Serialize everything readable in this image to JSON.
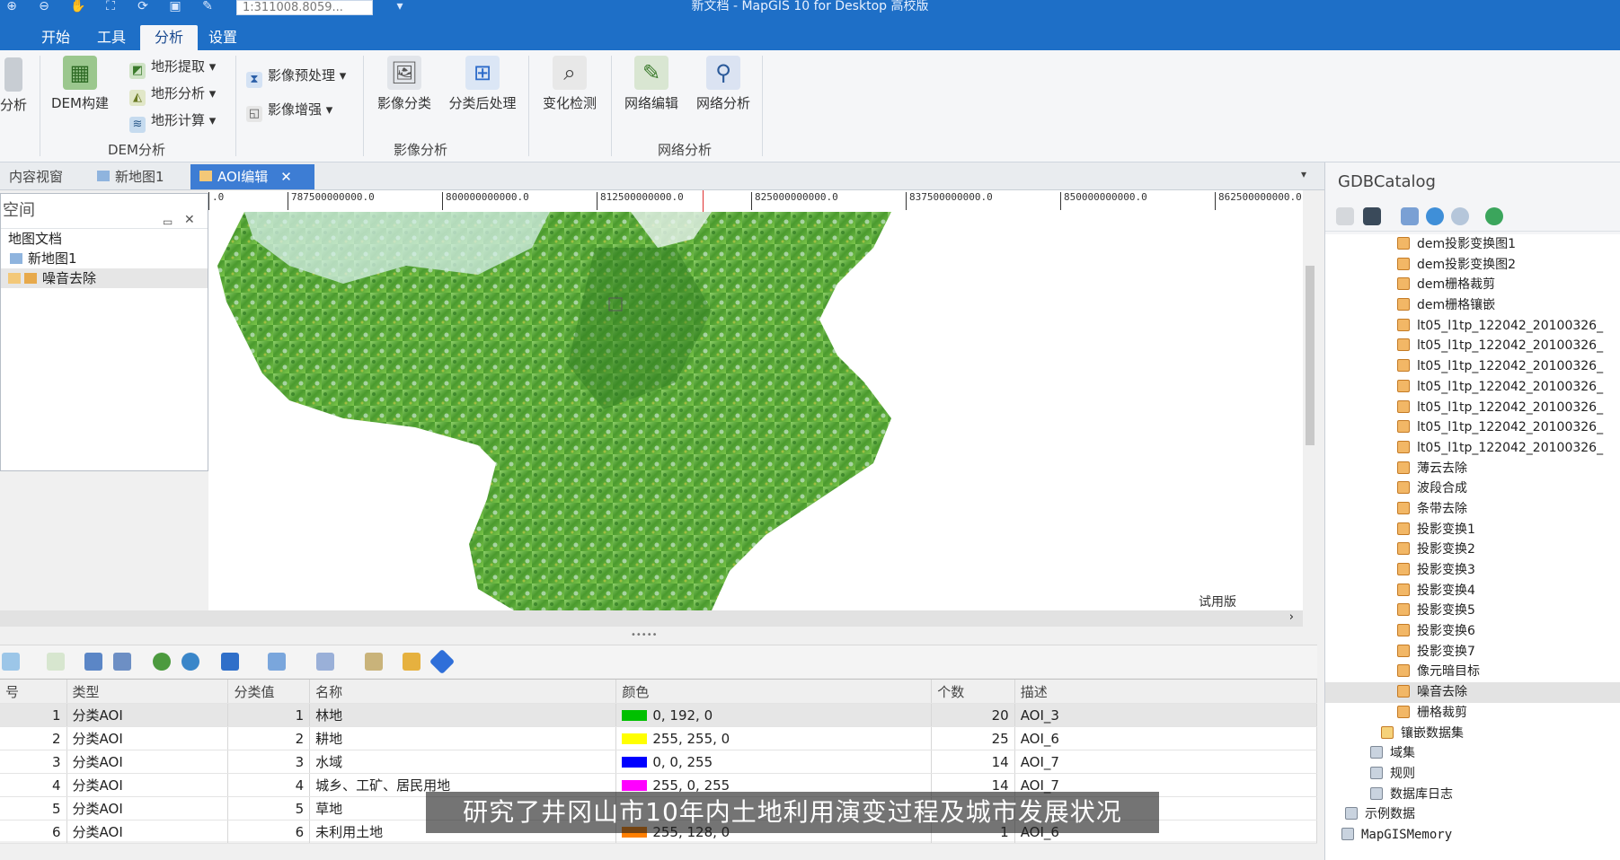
{
  "window": {
    "title": "新文档 - MapGIS 10 for Desktop 高校版",
    "scale_value": "1:311008.8059..."
  },
  "ribbon_tabs": [
    {
      "label": "开始"
    },
    {
      "label": "工具"
    },
    {
      "label": "分析"
    },
    {
      "label": "设置"
    }
  ],
  "ribbon": {
    "partial_left": "分析",
    "dem_build": "DEM构建",
    "terrain_extract": "地形提取",
    "terrain_analysis": "地形分析",
    "terrain_calc": "地形计算",
    "group_dem": "DEM分析",
    "img_preprocess": "影像预处理",
    "img_enhance": "影像增强",
    "img_classify": "影像分类",
    "post_classify": "分类后处理",
    "change_detect": "变化检测",
    "group_image": "影像分析",
    "net_edit": "网络编辑",
    "net_analysis": "网络分析",
    "group_network": "网络分析"
  },
  "doc_tabs": [
    {
      "label": "内容视窗"
    },
    {
      "label": "新地图1"
    },
    {
      "label": "AOI编辑"
    }
  ],
  "ruler_ticks": [
    ".0",
    "787500000000.0",
    "800000000000.0",
    "812500000000.0",
    "825000000000.0",
    "837500000000.0",
    "850000000000.0",
    "862500000000.0"
  ],
  "left_panel": {
    "title": "空间",
    "items": [
      "地图文档",
      "新地图1",
      "噪音去除"
    ]
  },
  "map": {
    "trial_label": "试用版"
  },
  "table": {
    "headers": [
      "号",
      "类型",
      "分类值",
      "名称",
      "颜色",
      "个数",
      "描述"
    ],
    "rows": [
      {
        "id": "1",
        "type": "分类AOI",
        "val": "1",
        "name": "林地",
        "color": "0, 192, 0",
        "hex": "#00c000",
        "count": "20",
        "desc": "AOI_3"
      },
      {
        "id": "2",
        "type": "分类AOI",
        "val": "2",
        "name": "耕地",
        "color": "255, 255, 0",
        "hex": "#ffff00",
        "count": "25",
        "desc": "AOI_6"
      },
      {
        "id": "3",
        "type": "分类AOI",
        "val": "3",
        "name": "水域",
        "color": "0, 0, 255",
        "hex": "#0000ff",
        "count": "14",
        "desc": "AOI_7"
      },
      {
        "id": "4",
        "type": "分类AOI",
        "val": "4",
        "name": "城乡、工矿、居民用地",
        "color": "255, 0, 255",
        "hex": "#ff00ff",
        "count": "14",
        "desc": "AOI_7"
      },
      {
        "id": "5",
        "type": "分类AOI",
        "val": "5",
        "name": "草地",
        "color": "",
        "hex": "",
        "count": "",
        "desc": ""
      },
      {
        "id": "6",
        "type": "分类AOI",
        "val": "6",
        "name": "未利用土地",
        "color": "255, 128, 0",
        "hex": "#ff8000",
        "count": "1",
        "desc": "AOI_6"
      }
    ]
  },
  "catalog": {
    "title": "GDBCatalog",
    "items": [
      {
        "label": "dem投影变换图1",
        "indent": 1
      },
      {
        "label": "dem投影变换图2",
        "indent": 1
      },
      {
        "label": "dem栅格裁剪",
        "indent": 1
      },
      {
        "label": "dem栅格镶嵌",
        "indent": 1
      },
      {
        "label": "lt05_l1tp_122042_20100326_",
        "indent": 1
      },
      {
        "label": "lt05_l1tp_122042_20100326_",
        "indent": 1
      },
      {
        "label": "lt05_l1tp_122042_20100326_",
        "indent": 1
      },
      {
        "label": "lt05_l1tp_122042_20100326_",
        "indent": 1
      },
      {
        "label": "lt05_l1tp_122042_20100326_",
        "indent": 1
      },
      {
        "label": "lt05_l1tp_122042_20100326_",
        "indent": 1
      },
      {
        "label": "lt05_l1tp_122042_20100326_",
        "indent": 1
      },
      {
        "label": "薄云去除",
        "indent": 1
      },
      {
        "label": "波段合成",
        "indent": 1
      },
      {
        "label": "条带去除",
        "indent": 1
      },
      {
        "label": "投影变换1",
        "indent": 1
      },
      {
        "label": "投影变换2",
        "indent": 1
      },
      {
        "label": "投影变换3",
        "indent": 1
      },
      {
        "label": "投影变换4",
        "indent": 1
      },
      {
        "label": "投影变换5",
        "indent": 1
      },
      {
        "label": "投影变换6",
        "indent": 1
      },
      {
        "label": "投影变换7",
        "indent": 1
      },
      {
        "label": "像元暗目标",
        "indent": 1
      },
      {
        "label": "噪音去除",
        "indent": 1,
        "selected": true
      },
      {
        "label": "栅格裁剪",
        "indent": 1
      },
      {
        "label": "镶嵌数据集",
        "indent": 2
      },
      {
        "label": "域集",
        "indent": 3
      },
      {
        "label": "规则",
        "indent": 3
      },
      {
        "label": "数据库日志",
        "indent": 3
      },
      {
        "label": "示例数据",
        "indent": 4
      },
      {
        "label": "MapGISMemory",
        "indent": 5
      }
    ]
  },
  "subtitle": "研究了井冈山市10年内土地利用演变过程及城市发展状况"
}
